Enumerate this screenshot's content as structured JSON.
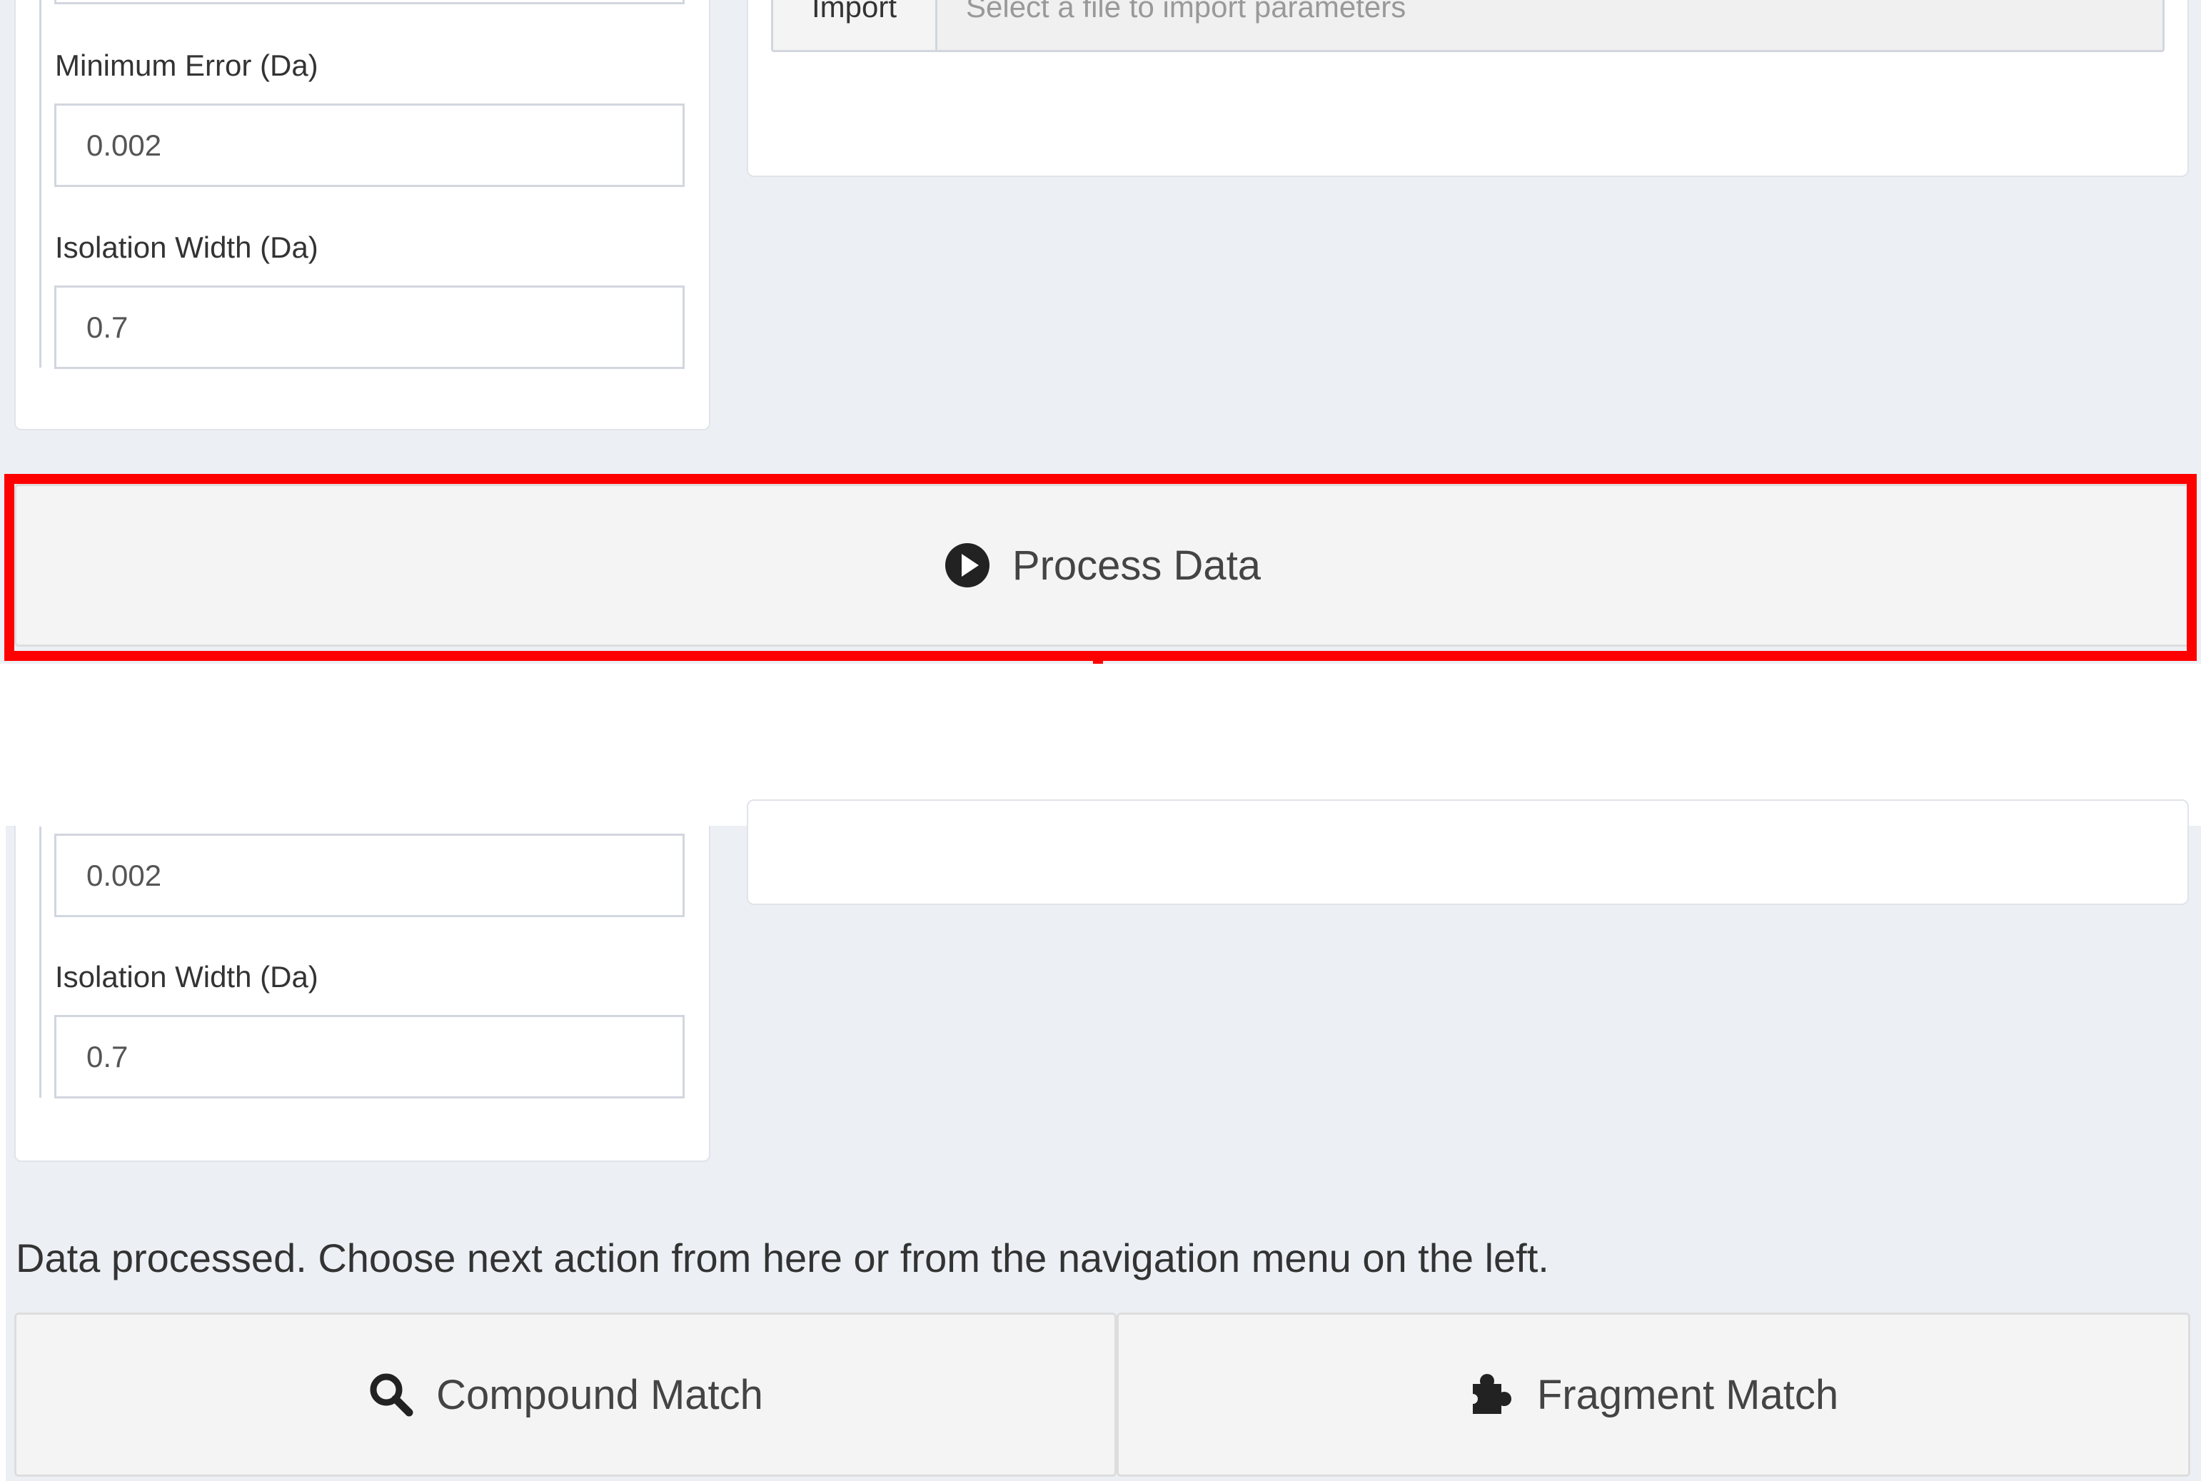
{
  "top": {
    "min_error_label": "Minimum Error (Da)",
    "min_error_value": "0.002",
    "isolation_label": "Isolation Width (Da)",
    "isolation_value": "0.7",
    "import_label": "Import",
    "import_placeholder": "Select a file to import parameters"
  },
  "process_button": {
    "label": "Process Data",
    "icon": "play-circle-icon"
  },
  "bottom": {
    "min_error_value": "0.002",
    "isolation_label": "Isolation Width (Da)",
    "isolation_value": "0.7",
    "status_message": "Data processed. Choose next action from here or from the navigation menu on the left.",
    "compound_match_label": "Compound Match",
    "compound_match_icon": "search-icon",
    "fragment_match_label": "Fragment Match",
    "fragment_match_icon": "puzzle-icon"
  },
  "colors": {
    "highlight": "#ff0000",
    "background": "#ecf0f5",
    "button": "#f4f4f4"
  }
}
